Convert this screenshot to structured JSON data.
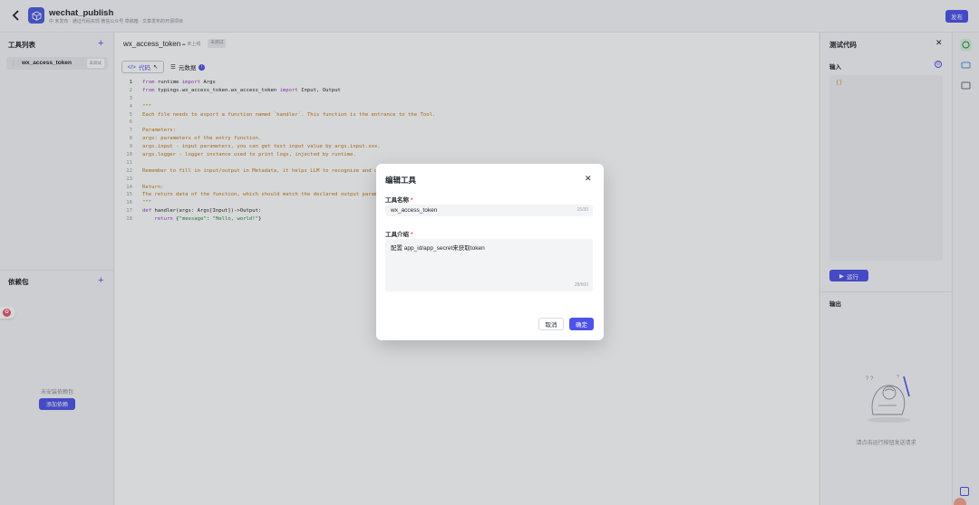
{
  "header": {
    "title": "wechat_publish",
    "subtitle": "中 未发布 · 通过代码实现 微信公众号 草稿箱 · 文章发布的开源项目",
    "publish_label": "发布"
  },
  "sidebar": {
    "tools_title": "工具列表",
    "tool_item": {
      "name": "wx_access_token",
      "tag": "未调试"
    },
    "deps_title": "依赖包",
    "deps_empty": "未安装依赖包",
    "add_dep_label": "添加依赖"
  },
  "editor": {
    "file_title": "wx_access_token",
    "file_status": "未上线",
    "file_tag": "未调试",
    "tab_code": "代码",
    "tab_meta": "元数据",
    "lines": [
      {
        "n": "1",
        "segments": [
          [
            "kw",
            "from"
          ],
          [
            "def",
            " runtime "
          ],
          [
            "kw",
            "import"
          ],
          [
            "def",
            " Args"
          ]
        ]
      },
      {
        "n": "2",
        "segments": [
          [
            "kw",
            "from"
          ],
          [
            "def",
            " typings.wx_access_token.wx_access_token "
          ],
          [
            "kw",
            "import"
          ],
          [
            "def",
            " Input, Output"
          ]
        ]
      },
      {
        "n": "3",
        "segments": []
      },
      {
        "n": "4",
        "segments": [
          [
            "cmt",
            "\"\"\""
          ]
        ]
      },
      {
        "n": "5",
        "segments": [
          [
            "cmt",
            "Each file needs to export a function named `handler`. This function is the entrance to the Tool."
          ]
        ]
      },
      {
        "n": "6",
        "segments": []
      },
      {
        "n": "7",
        "segments": [
          [
            "cmt",
            "Parameters:"
          ]
        ]
      },
      {
        "n": "8",
        "segments": [
          [
            "cmt",
            "args: parameters of the entry function."
          ]
        ]
      },
      {
        "n": "9",
        "segments": [
          [
            "cmt",
            "args.input - input parameters, you can get test input value by args.input.xxx."
          ]
        ]
      },
      {
        "n": "10",
        "segments": [
          [
            "cmt",
            "args.logger - logger instance used to print logs, injected by runtime."
          ]
        ]
      },
      {
        "n": "11",
        "segments": []
      },
      {
        "n": "12",
        "segments": [
          [
            "cmt",
            "Remember to fill in input/output in Metadata, it helps LLM to recognize and use tool."
          ]
        ]
      },
      {
        "n": "13",
        "segments": []
      },
      {
        "n": "14",
        "segments": [
          [
            "cmt",
            "Return:"
          ]
        ]
      },
      {
        "n": "15",
        "segments": [
          [
            "cmt",
            "The return data of the function, which should match the declared output parameters."
          ]
        ]
      },
      {
        "n": "16",
        "segments": [
          [
            "cmt",
            "\"\"\""
          ]
        ]
      },
      {
        "n": "17",
        "segments": [
          [
            "kw",
            "def"
          ],
          [
            "def",
            " handler(args: Args[Input])->Output:"
          ]
        ]
      },
      {
        "n": "18",
        "segments": [
          [
            "def",
            "    "
          ],
          [
            "kw",
            "return"
          ],
          [
            "def",
            " {"
          ],
          [
            "str",
            "\"message\""
          ],
          [
            "def",
            ": "
          ],
          [
            "str",
            "\"Hello, world!\""
          ],
          [
            "def",
            "}"
          ]
        ]
      }
    ]
  },
  "test_panel": {
    "title": "测试代码",
    "input_label": "输入",
    "input_value": "{}",
    "run_label": "运行",
    "output_label": "输出",
    "output_empty": "请点击运行按钮发送请求"
  },
  "modal": {
    "title": "编辑工具",
    "name_label": "工具名称",
    "name_value": "wx_access_token",
    "name_count": "15/30",
    "desc_label": "工具介绍",
    "desc_value": "配置 app_id/app_secret来获取token",
    "desc_count": "28/600",
    "cancel_label": "取消",
    "ok_label": "确定"
  },
  "colors": {
    "accent": "#4d53e8",
    "required": "#e5484d"
  }
}
